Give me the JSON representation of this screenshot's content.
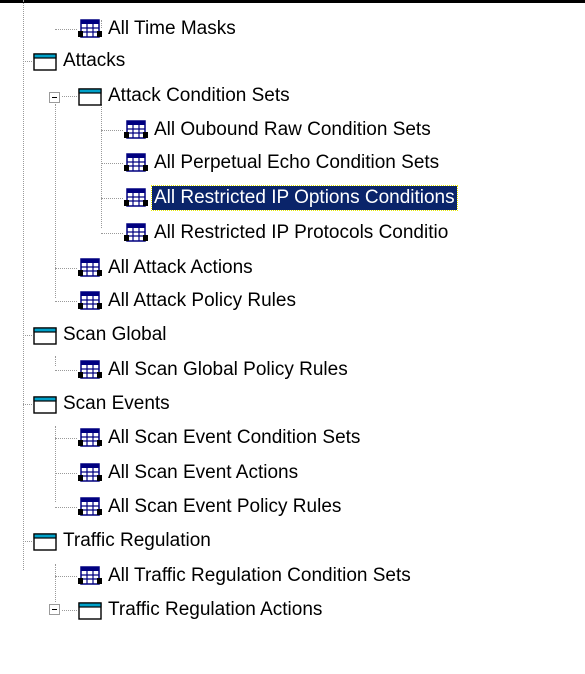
{
  "tree": {
    "nodes": [
      {
        "label": "All Time Masks",
        "icon": "table-icon",
        "level": 2,
        "name": "all-time-masks"
      },
      {
        "label": "Attacks",
        "icon": "folder-icon",
        "level": 1,
        "name": "attacks"
      },
      {
        "label": "Attack Condition Sets",
        "icon": "folder-icon",
        "level": 2,
        "name": "attack-condition-sets",
        "expanded": true
      },
      {
        "label": "All Oubound Raw Condition Sets",
        "icon": "table-icon",
        "level": 3,
        "name": "all-oubound-raw-condition-sets"
      },
      {
        "label": "All Perpetual Echo Condition Sets",
        "icon": "table-icon",
        "level": 3,
        "name": "all-perpetual-echo-condition-sets"
      },
      {
        "label": "All Restricted IP Options Conditions",
        "icon": "table-icon",
        "level": 3,
        "name": "all-restricted-ip-options-condition-sets",
        "selected": true
      },
      {
        "label": "All Restricted IP Protocols Conditio",
        "icon": "table-icon",
        "level": 3,
        "name": "all-restricted-ip-protocols-condition-sets"
      },
      {
        "label": "All Attack Actions",
        "icon": "table-icon",
        "level": 2,
        "name": "all-attack-actions"
      },
      {
        "label": "All Attack Policy Rules",
        "icon": "table-icon",
        "level": 2,
        "name": "all-attack-policy-rules"
      },
      {
        "label": "Scan Global",
        "icon": "folder-icon",
        "level": 1,
        "name": "scan-global"
      },
      {
        "label": "All Scan Global Policy Rules",
        "icon": "table-icon",
        "level": 2,
        "name": "all-scan-global-policy-rules"
      },
      {
        "label": "Scan Events",
        "icon": "folder-icon",
        "level": 1,
        "name": "scan-events"
      },
      {
        "label": "All Scan Event Condition Sets",
        "icon": "table-icon",
        "level": 2,
        "name": "all-scan-event-condition-sets"
      },
      {
        "label": "All Scan Event Actions",
        "icon": "table-icon",
        "level": 2,
        "name": "all-scan-event-actions"
      },
      {
        "label": "All Scan Event Policy Rules",
        "icon": "table-icon",
        "level": 2,
        "name": "all-scan-event-policy-rules"
      },
      {
        "label": "Traffic Regulation",
        "icon": "folder-icon",
        "level": 1,
        "name": "traffic-regulation"
      },
      {
        "label": "All Traffic Regulation Condition Sets",
        "icon": "table-icon",
        "level": 2,
        "name": "all-traffic-regulation-condition-sets"
      },
      {
        "label": "Traffic Regulation Actions",
        "icon": "folder-icon",
        "level": 2,
        "name": "traffic-regulation-actions",
        "expanded": true
      }
    ]
  },
  "colors": {
    "selection_bg": "#0a246a",
    "selection_text": "#ffffff",
    "focus_outline": "#e8e800",
    "tree_lines": "#9a9a9a",
    "folder_tab": "#00a0c8",
    "table_icon": "#000080"
  }
}
